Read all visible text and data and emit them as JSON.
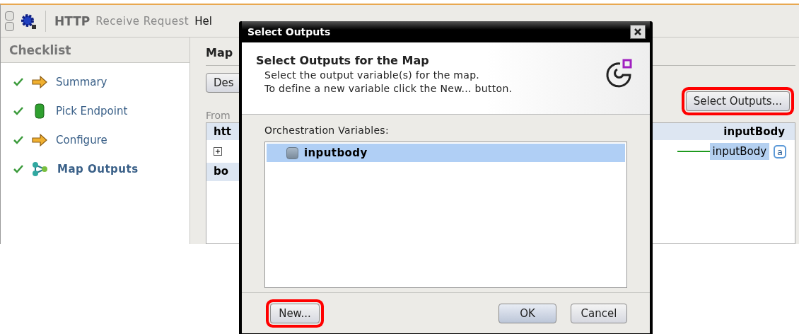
{
  "header": {
    "product": "HTTP",
    "subtitle": "Receive Request",
    "name": "Hel"
  },
  "checklist": {
    "title": "Checklist",
    "items": [
      {
        "label": "Summary",
        "checked": true,
        "kind": "arrow",
        "selected": false
      },
      {
        "label": "Pick Endpoint",
        "checked": true,
        "kind": "cylinder",
        "selected": false
      },
      {
        "label": "Configure",
        "checked": true,
        "kind": "arrow",
        "selected": false
      },
      {
        "label": "Map Outputs",
        "checked": true,
        "kind": "network",
        "selected": true
      }
    ]
  },
  "main": {
    "title": "Map",
    "tab_button": "Des",
    "from_label": "From",
    "select_button": {
      "label": "Select Outputs...",
      "highlighted": true
    },
    "source": {
      "header": "htt",
      "section": "bo"
    },
    "target": {
      "header": "inputBody",
      "field": "inputBody",
      "type_badge": "a"
    }
  },
  "dialog": {
    "title": "Select Outputs",
    "heading": "Select Outputs for the Map",
    "lines": [
      "Select the output variable(s) for the map.",
      "To define a new variable click the New... button."
    ],
    "list_label": "Orchestration Variables:",
    "variables": [
      {
        "name": "inputbody",
        "selected": true,
        "checked": false
      }
    ],
    "new_button": {
      "label": "New...",
      "highlighted": true
    },
    "ok_button": "OK",
    "cancel_button": "Cancel"
  }
}
